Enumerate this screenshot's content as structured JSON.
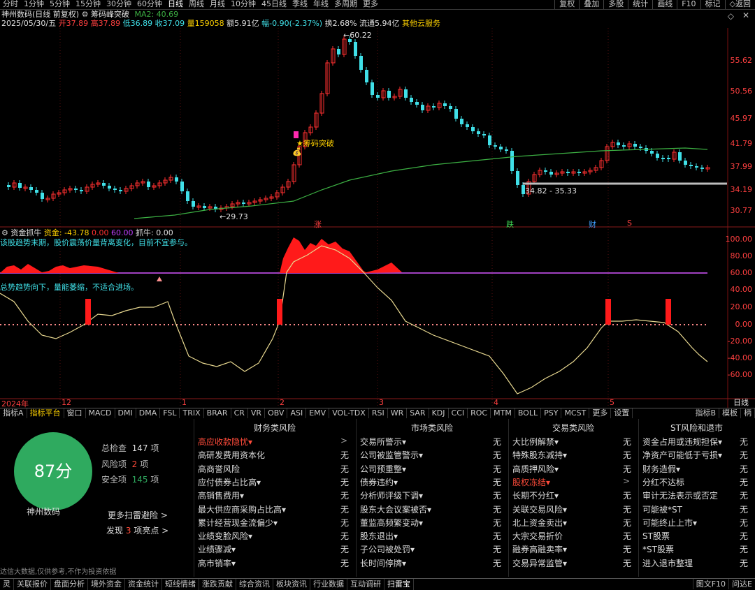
{
  "topbar": {
    "periods": [
      "分时",
      "1分钟",
      "5分钟",
      "15分钟",
      "30分钟",
      "60分钟",
      "日线",
      "周线",
      "月线",
      "10分钟",
      "45日线",
      "季线",
      "年线",
      "多周期",
      "更多"
    ],
    "active_period": "日线",
    "right_buttons": [
      "复权",
      "叠加",
      "多股",
      "统计",
      "画线",
      "F10",
      "标记",
      "◇返回"
    ]
  },
  "header": {
    "stock": "神州数码(日线 前复权)",
    "indicator": "筹码峰突破",
    "ma2": "MA2: 40.69",
    "date": "2025/05/30/五",
    "open": "开37.89",
    "high": "高37.89",
    "low": "低36.89",
    "close": "收37.09",
    "volume": "量159058",
    "amount": "额5.91亿",
    "change": "幅-0.90(-2.37%)",
    "turnover": "换2.68%",
    "float": "流通5.94亿",
    "other": "其他云服务"
  },
  "price_axis": [
    "55.62",
    "50.56",
    "45.97",
    "41.79",
    "37.99",
    "34.19",
    "30.77"
  ],
  "annotations": {
    "high": "60.22",
    "low": "29.73",
    "breakout": "★筹码突破",
    "range": "34.82 - 35.33",
    "event_zhang": "涨",
    "event_die": "跌",
    "event_cai": "财",
    "event_s": "S"
  },
  "indicator_panel": {
    "name": "资金抓牛",
    "zijin": "资金: -43.78",
    "val1": "0.00",
    "val2": "60.00",
    "zhuaniu": "抓牛: 0.00",
    "note1": "该股趋势末期，股价震荡价量背离变化，目前不宜参与。",
    "note2": "总势趋势向下，量能萎缩，不适合进场。",
    "axis": [
      "100.00",
      "80.00",
      "60.00",
      "40.00",
      "20.00",
      "0.00",
      "-20.00",
      "-40.00",
      "-60.00"
    ]
  },
  "time_axis": [
    "2024年",
    "12",
    "1",
    "2",
    "3",
    "4",
    "5"
  ],
  "period_right": "日线",
  "indicator_tabs": [
    "指标A",
    "指标平台",
    "窗口",
    "MACD",
    "DMI",
    "DMA",
    "FSL",
    "TRIX",
    "BRAR",
    "CR",
    "VR",
    "OBV",
    "ASI",
    "EMV",
    "VOL-TDX",
    "RSI",
    "WR",
    "SAR",
    "KDJ",
    "CCI",
    "ROC",
    "MTM",
    "BOLL",
    "PSY",
    "MCST",
    "更多",
    "设置"
  ],
  "indicator_tabs_active": "指标平台",
  "indicator_tabs_right": [
    "指标B",
    "模板",
    "柄"
  ],
  "risk": {
    "score": "87分",
    "total_label": "总检查",
    "total": "147",
    "unit": "项",
    "risk_label": "风险项",
    "risk": "2",
    "safe_label": "安全项",
    "safe": "145",
    "stock_name": "神州数码",
    "more": "更多扫雷避险 >",
    "discover": "发现",
    "discover_count": "3",
    "discover_tail": "项亮点 >",
    "source": "达信大数据,仅供参考,不作为投资依据",
    "columns": [
      {
        "title": "财务类风险",
        "items": [
          {
            "label": "高应收款隐忧▾",
            "status": ">",
            "red": true
          },
          {
            "label": "高研发费用资本化",
            "status": "无"
          },
          {
            "label": "高商誉风险",
            "status": "无"
          },
          {
            "label": "应付债券占比高▾",
            "status": "无"
          },
          {
            "label": "高销售费用▾",
            "status": "无"
          },
          {
            "label": "最大供应商采购占比高▾",
            "status": "无"
          },
          {
            "label": "累计经营现金流偏少▾",
            "status": "无"
          },
          {
            "label": "业绩变脸风险▾",
            "status": "无"
          },
          {
            "label": "业绩骤减▾",
            "status": "无"
          },
          {
            "label": "高市销率▾",
            "status": "无"
          }
        ]
      },
      {
        "title": "市场类风险",
        "items": [
          {
            "label": "交易所警示▾",
            "status": "无"
          },
          {
            "label": "公司被监管警示▾",
            "status": "无"
          },
          {
            "label": "公司预重整▾",
            "status": "无"
          },
          {
            "label": "债券违约▾",
            "status": "无"
          },
          {
            "label": "分析师评级下调▾",
            "status": "无"
          },
          {
            "label": "股东大会议案被否▾",
            "status": "无"
          },
          {
            "label": "董监高频繁变动▾",
            "status": "无"
          },
          {
            "label": "股东退出▾",
            "status": "无"
          },
          {
            "label": "子公司被处罚▾",
            "status": "无"
          },
          {
            "label": "长时间停牌▾",
            "status": "无"
          }
        ]
      },
      {
        "title": "交易类风险",
        "items": [
          {
            "label": "大比例解禁▾",
            "status": "无"
          },
          {
            "label": "特殊股东减持▾",
            "status": "无"
          },
          {
            "label": "高质押风险▾",
            "status": "无"
          },
          {
            "label": "股权冻结▾",
            "status": ">",
            "red": true
          },
          {
            "label": "长期不分红▾",
            "status": "无"
          },
          {
            "label": "关联交易风险▾",
            "status": "无"
          },
          {
            "label": "北上资金卖出▾",
            "status": "无"
          },
          {
            "label": "大宗交易折价",
            "status": "无"
          },
          {
            "label": "融券高融卖率▾",
            "status": "无"
          },
          {
            "label": "交易异常监管▾",
            "status": "无"
          }
        ]
      },
      {
        "title": "ST风险和退市",
        "items": [
          {
            "label": "资金占用或违规担保▾",
            "status": "无"
          },
          {
            "label": "净资产可能低于亏损▾",
            "status": "无"
          },
          {
            "label": "财务造假▾",
            "status": "无"
          },
          {
            "label": "分红不达标",
            "status": "无"
          },
          {
            "label": "审计无法表示或否定",
            "status": "无"
          },
          {
            "label": "可能被*ST",
            "status": "无"
          },
          {
            "label": "可能终止上市▾",
            "status": "无"
          },
          {
            "label": "ST股票",
            "status": "无"
          },
          {
            "label": "*ST股票",
            "status": "无"
          },
          {
            "label": "进入退市整理",
            "status": "无"
          }
        ]
      }
    ]
  },
  "bottom_tabs": [
    "灵",
    "关联报价",
    "盘面分析",
    "境外资金",
    "资金统计",
    "短线情绪",
    "涨跌贡献",
    "综合资讯",
    "板块资讯",
    "行业数据",
    "互动调研",
    "扫雷宝"
  ],
  "bottom_tabs_active": "扫雷宝",
  "bottom_right": [
    "图文F10",
    "问达E"
  ],
  "colors": {
    "up": "#ff3030",
    "down": "#40e0e8",
    "ma": "#3cb043",
    "accent": "#ffd200",
    "score": "#2faa5f"
  }
}
